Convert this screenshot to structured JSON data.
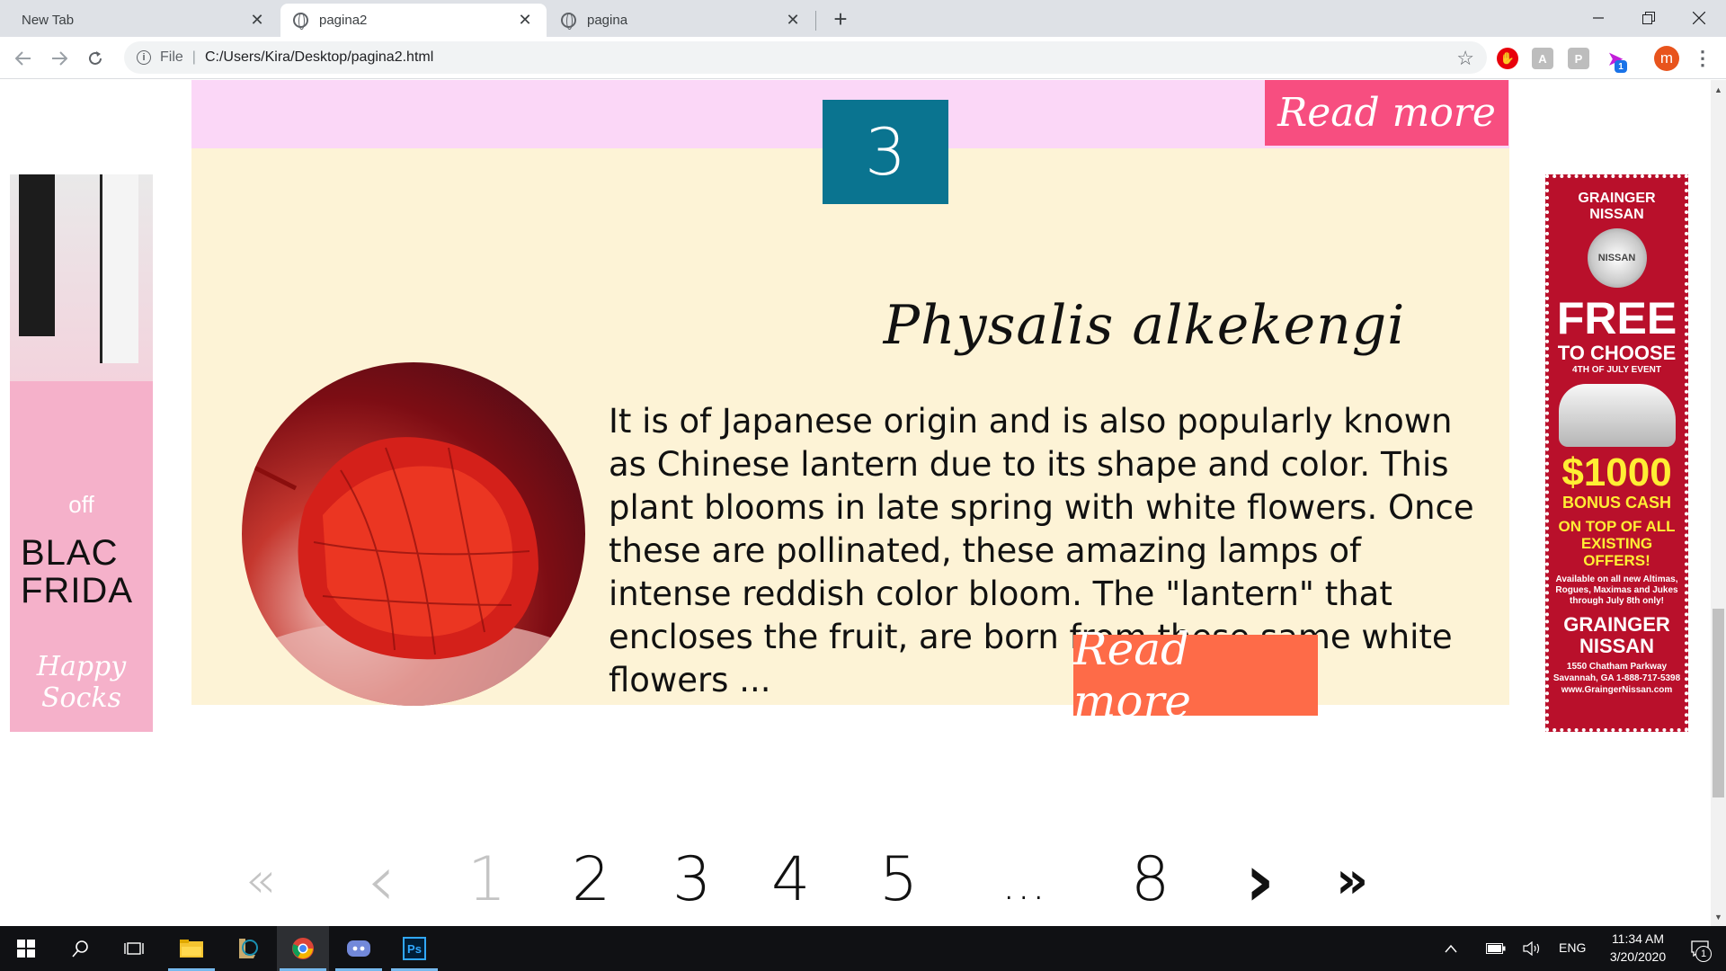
{
  "browser": {
    "tabs": [
      {
        "title": "New Tab"
      },
      {
        "title": "pagina2"
      },
      {
        "title": "pagina"
      }
    ],
    "new_tab_symbol": "+",
    "close_symbol": "✕",
    "address": {
      "scheme": "File",
      "path": "C:/Users/Kira/Desktop/pagina2.html"
    },
    "profile_initial": "m",
    "extension_badge": "1"
  },
  "page": {
    "previous_card": {
      "read_more": "Read more",
      "color": "#fbd7f7",
      "button_color": "#f74e80"
    },
    "card": {
      "number": "3",
      "title": "Physalis alkekengi",
      "text": "It is of Japanese origin and is also popularly known as Chinese lantern due to its shape and color. This plant blooms in late spring with white flowers. Once these are pollinated, these amazing lamps of intense reddish color bloom. The \"lantern\" that encloses the fruit, are born from these same white flowers ...",
      "read_more": "Read more",
      "background": "#fdf3d6",
      "number_color": "#0a7490",
      "button_color": "#fe6b48"
    },
    "ad_left": {
      "off": "off",
      "headline_1": "BLAC",
      "headline_2": "FRIDA",
      "brand": "Happy Socks"
    },
    "ad_right": {
      "dealer": "GRAINGER NISSAN",
      "logo": "NISSAN",
      "free": "FREE",
      "to_choose": "TO CHOOSE",
      "event": "4TH OF JULY EVENT",
      "cash": "$1000",
      "bonus": "BONUS CASH",
      "on_top": "ON TOP OF ALL EXISTING OFFERS!",
      "fine_print": "Available on all new Altimas, Rogues, Maximas and Jukes through July 8th only!",
      "name": "GRAINGER NISSAN",
      "address": "1550 Chatham Parkway Savannah, GA 1-888-717-5398 www.GraingerNissan.com"
    },
    "pagination": {
      "first": "«",
      "prev": "‹",
      "pages": [
        "1",
        "2",
        "3",
        "4",
        "5"
      ],
      "ellipsis": "...",
      "last_page": "8",
      "next": "›",
      "last": "»",
      "current": "1"
    }
  },
  "taskbar": {
    "language": "ENG",
    "time": "11:34 AM",
    "date": "3/20/2020",
    "notification_count": "1",
    "photoshop": "Ps"
  }
}
